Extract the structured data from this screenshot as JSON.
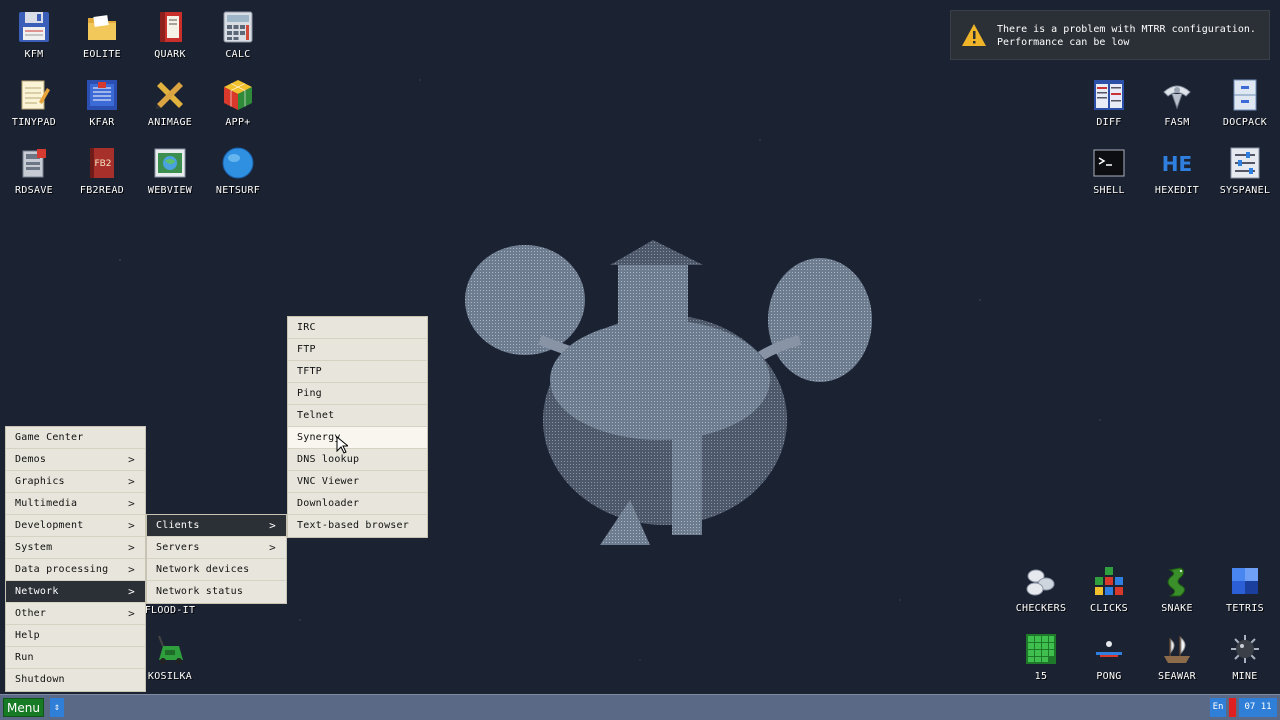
{
  "desktop": {
    "icons_left": [
      {
        "label": "KFM",
        "icon": "floppy-icon"
      },
      {
        "label": "EOLITE",
        "icon": "folder-icon"
      },
      {
        "label": "QUARK",
        "icon": "book-icon"
      },
      {
        "label": "CALC",
        "icon": "calculator-icon"
      },
      {
        "label": "TINYPAD",
        "icon": "notepad-icon"
      },
      {
        "label": "KFAR",
        "icon": "archive-icon"
      },
      {
        "label": "ANIMAGE",
        "icon": "pencil-ruler-icon"
      },
      {
        "label": "APP+",
        "icon": "cube-icon"
      },
      {
        "label": "RDSAVE",
        "icon": "ramdisk-icon"
      },
      {
        "label": "FB2READ",
        "icon": "fb2-book-icon"
      },
      {
        "label": "WEBVIEW",
        "icon": "webview-icon"
      },
      {
        "label": "NETSURF",
        "icon": "globe-icon"
      },
      {
        "label": "FLOOD-IT",
        "icon": "flood-it-icon"
      },
      {
        "label": "KOSILKA",
        "icon": "lawnmower-icon"
      }
    ],
    "icons_right": [
      {
        "label": "DIFF",
        "icon": "diff-icon"
      },
      {
        "label": "FASM",
        "icon": "fasm-icon"
      },
      {
        "label": "DOCPACK",
        "icon": "cabinet-icon"
      },
      {
        "label": "SHELL",
        "icon": "terminal-icon"
      },
      {
        "label": "HEXEDIT",
        "icon": "hex-editor-icon"
      },
      {
        "label": "SYSPANEL",
        "icon": "sliders-icon"
      },
      {
        "label": "CHECKERS",
        "icon": "checkers-icon"
      },
      {
        "label": "CLICKS",
        "icon": "clicks-icon"
      },
      {
        "label": "SNAKE",
        "icon": "snake-icon"
      },
      {
        "label": "TETRIS",
        "icon": "tetris-icon"
      },
      {
        "label": "15",
        "icon": "fifteen-puzzle-icon"
      },
      {
        "label": "PONG",
        "icon": "pong-icon"
      },
      {
        "label": "SEAWAR",
        "icon": "ship-icon"
      },
      {
        "label": "MINE",
        "icon": "mine-icon"
      }
    ]
  },
  "notification": {
    "line1": "There is a problem with MTRR configuration.",
    "line2": "Performance can be low",
    "icon": "warning-icon"
  },
  "main_menu": {
    "items": [
      {
        "label": "Game Center",
        "has_sub": false
      },
      {
        "label": "Demos",
        "has_sub": true
      },
      {
        "label": "Graphics",
        "has_sub": true
      },
      {
        "label": "Multimedia",
        "has_sub": true
      },
      {
        "label": "Development",
        "has_sub": true
      },
      {
        "label": "System",
        "has_sub": true
      },
      {
        "label": "Data processing",
        "has_sub": true
      },
      {
        "label": "Network",
        "has_sub": true
      },
      {
        "label": "Other",
        "has_sub": true
      },
      {
        "label": "Help",
        "has_sub": false
      },
      {
        "label": "Run",
        "has_sub": false
      },
      {
        "label": "Shutdown",
        "has_sub": false
      }
    ],
    "arrow": ">"
  },
  "network_menu": {
    "items": [
      {
        "label": "Clients",
        "has_sub": true
      },
      {
        "label": "Servers",
        "has_sub": true
      },
      {
        "label": "Network devices",
        "has_sub": false
      },
      {
        "label": "Network status",
        "has_sub": false
      }
    ]
  },
  "clients_menu": {
    "items": [
      {
        "label": "IRC"
      },
      {
        "label": "FTP"
      },
      {
        "label": "TFTP"
      },
      {
        "label": "Ping"
      },
      {
        "label": "Telnet"
      },
      {
        "label": "Synergy"
      },
      {
        "label": "DNS lookup"
      },
      {
        "label": "VNC Viewer"
      },
      {
        "label": "Downloader"
      },
      {
        "label": "Text-based browser"
      }
    ]
  },
  "taskbar": {
    "menu_label": "Menu",
    "swap_symbol": "⇕",
    "language": "En",
    "clock": "07 11"
  },
  "colors": {
    "desktop_bg": "#1b2333",
    "menu_bg": "#e8e6dc",
    "menu_active_bg": "#2b2f36",
    "taskbar_bg": "#5a6a86",
    "menu_button_bg": "#177a24",
    "accent_blue": "#2f7fd8"
  }
}
